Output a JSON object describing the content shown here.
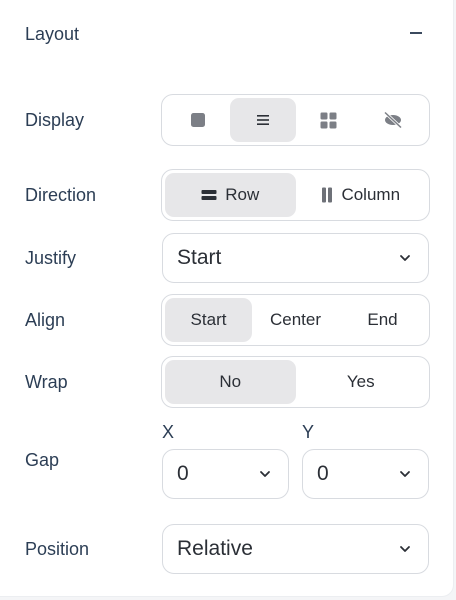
{
  "section": {
    "title": "Layout"
  },
  "display": {
    "label": "Display",
    "options": [
      "block-icon",
      "flex-icon",
      "grid-icon",
      "hidden-icon"
    ],
    "selected": 1
  },
  "direction": {
    "label": "Direction",
    "row_label": "Row",
    "column_label": "Column",
    "selected": "Row"
  },
  "justify": {
    "label": "Justify",
    "value": "Start"
  },
  "align": {
    "label": "Align",
    "options": [
      "Start",
      "Center",
      "End"
    ],
    "selected": "Start"
  },
  "wrap": {
    "label": "Wrap",
    "options": [
      "No",
      "Yes"
    ],
    "selected": "No"
  },
  "gap": {
    "label": "Gap",
    "x_label": "X",
    "y_label": "Y",
    "x_value": "0",
    "y_value": "0"
  },
  "position": {
    "label": "Position",
    "value": "Relative"
  },
  "colors": {
    "text": "#2c3e55",
    "border": "#d8dbe0",
    "active": "#e7e7e9"
  }
}
